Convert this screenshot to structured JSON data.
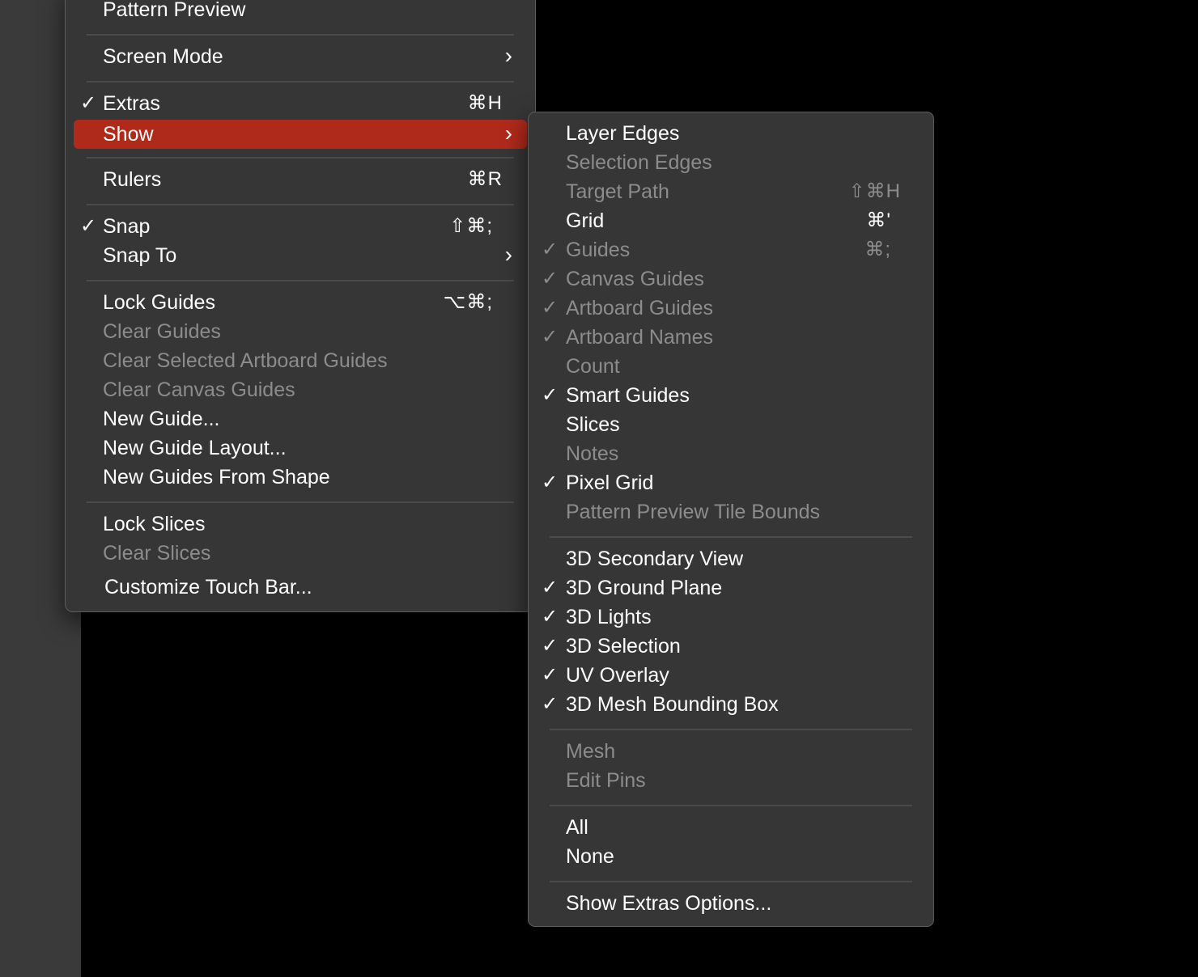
{
  "view_menu": {
    "items": [
      {
        "label": "Pattern Preview",
        "checked": false,
        "enabled": true,
        "shortcut": "",
        "submenu": false
      },
      {
        "label": "Screen Mode",
        "checked": false,
        "enabled": true,
        "shortcut": "",
        "submenu": true
      },
      {
        "label": "Extras",
        "checked": true,
        "enabled": true,
        "shortcut": "⌘H",
        "submenu": false
      },
      {
        "label": "Show",
        "checked": false,
        "enabled": true,
        "shortcut": "",
        "submenu": true,
        "highlighted": true
      },
      {
        "label": "Rulers",
        "checked": false,
        "enabled": true,
        "shortcut": "⌘R",
        "submenu": false
      },
      {
        "label": "Snap",
        "checked": true,
        "enabled": true,
        "shortcut": "⇧⌘;",
        "submenu": false
      },
      {
        "label": "Snap To",
        "checked": false,
        "enabled": true,
        "shortcut": "",
        "submenu": true
      },
      {
        "label": "Lock Guides",
        "checked": false,
        "enabled": true,
        "shortcut": "⌥⌘;",
        "submenu": false
      },
      {
        "label": "Clear Guides",
        "checked": false,
        "enabled": false,
        "shortcut": "",
        "submenu": false
      },
      {
        "label": "Clear Selected Artboard Guides",
        "checked": false,
        "enabled": false,
        "shortcut": "",
        "submenu": false
      },
      {
        "label": "Clear Canvas Guides",
        "checked": false,
        "enabled": false,
        "shortcut": "",
        "submenu": false
      },
      {
        "label": "New Guide...",
        "checked": false,
        "enabled": true,
        "shortcut": "",
        "submenu": false
      },
      {
        "label": "New Guide Layout...",
        "checked": false,
        "enabled": true,
        "shortcut": "",
        "submenu": false
      },
      {
        "label": "New Guides From Shape",
        "checked": false,
        "enabled": true,
        "shortcut": "",
        "submenu": false
      },
      {
        "label": "Lock Slices",
        "checked": false,
        "enabled": true,
        "shortcut": "",
        "submenu": false
      },
      {
        "label": "Clear Slices",
        "checked": false,
        "enabled": false,
        "shortcut": "",
        "submenu": false
      },
      {
        "label": "Customize Touch Bar...",
        "checked": false,
        "enabled": true,
        "shortcut": "",
        "submenu": false
      }
    ]
  },
  "show_submenu": {
    "items": [
      {
        "label": "Layer Edges",
        "checked": false,
        "enabled": true,
        "shortcut": ""
      },
      {
        "label": "Selection Edges",
        "checked": false,
        "enabled": false,
        "shortcut": ""
      },
      {
        "label": "Target Path",
        "checked": false,
        "enabled": false,
        "shortcut": "⇧⌘H"
      },
      {
        "label": "Grid",
        "checked": false,
        "enabled": true,
        "shortcut": "⌘'"
      },
      {
        "label": "Guides",
        "checked": true,
        "enabled": false,
        "shortcut": "⌘;"
      },
      {
        "label": "Canvas Guides",
        "checked": true,
        "enabled": false,
        "shortcut": ""
      },
      {
        "label": "Artboard Guides",
        "checked": true,
        "enabled": false,
        "shortcut": ""
      },
      {
        "label": "Artboard Names",
        "checked": true,
        "enabled": false,
        "shortcut": ""
      },
      {
        "label": "Count",
        "checked": false,
        "enabled": false,
        "shortcut": ""
      },
      {
        "label": "Smart Guides",
        "checked": true,
        "enabled": true,
        "shortcut": ""
      },
      {
        "label": "Slices",
        "checked": false,
        "enabled": true,
        "shortcut": ""
      },
      {
        "label": "Notes",
        "checked": false,
        "enabled": false,
        "shortcut": ""
      },
      {
        "label": "Pixel Grid",
        "checked": true,
        "enabled": true,
        "shortcut": ""
      },
      {
        "label": "Pattern Preview Tile Bounds",
        "checked": false,
        "enabled": false,
        "shortcut": ""
      },
      {
        "label": "3D Secondary View",
        "checked": false,
        "enabled": true,
        "shortcut": ""
      },
      {
        "label": "3D Ground Plane",
        "checked": true,
        "enabled": true,
        "shortcut": ""
      },
      {
        "label": "3D Lights",
        "checked": true,
        "enabled": true,
        "shortcut": ""
      },
      {
        "label": "3D Selection",
        "checked": true,
        "enabled": true,
        "shortcut": ""
      },
      {
        "label": "UV Overlay",
        "checked": true,
        "enabled": true,
        "shortcut": ""
      },
      {
        "label": "3D Mesh Bounding Box",
        "checked": true,
        "enabled": true,
        "shortcut": ""
      },
      {
        "label": "Mesh",
        "checked": false,
        "enabled": false,
        "shortcut": ""
      },
      {
        "label": "Edit Pins",
        "checked": false,
        "enabled": false,
        "shortcut": ""
      },
      {
        "label": "All",
        "checked": false,
        "enabled": true,
        "shortcut": ""
      },
      {
        "label": "None",
        "checked": false,
        "enabled": true,
        "shortcut": ""
      },
      {
        "label": "Show Extras Options...",
        "checked": false,
        "enabled": true,
        "shortcut": ""
      }
    ]
  },
  "icons": {
    "checkmark": "checkmark-icon",
    "submenu_arrow": "chevron-right-icon"
  },
  "colors": {
    "menu_bg": "#363636",
    "highlight": "#b02a1c",
    "text": "#ffffff",
    "disabled_text": "#8c8c8c"
  }
}
